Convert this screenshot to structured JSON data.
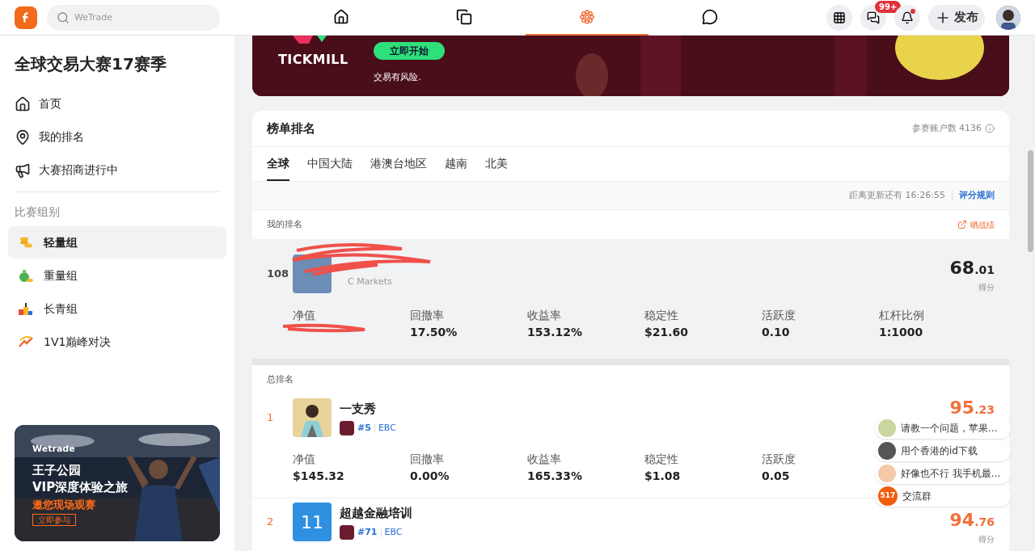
{
  "header": {
    "search": {
      "placeholder": "WeTrade"
    },
    "nav": [
      {
        "kind": "home",
        "selected": false
      },
      {
        "kind": "feed",
        "selected": false
      },
      {
        "kind": "contest",
        "selected": true
      },
      {
        "kind": "chat",
        "selected": false
      }
    ],
    "badge": "99+",
    "notification_dot": true,
    "publish": "发布"
  },
  "sidebar": {
    "title": "全球交易大赛17赛季",
    "links": [
      {
        "kind": "home",
        "label": "首页"
      },
      {
        "kind": "rank",
        "label": "我的排名"
      },
      {
        "kind": "megaphone",
        "label": "大赛招商进行中"
      }
    ],
    "section": "比赛组别",
    "groups": [
      {
        "kind": "coins",
        "label": "轻量组",
        "selected": true
      },
      {
        "kind": "moneybag",
        "label": "重量组",
        "selected": false
      },
      {
        "kind": "blocks",
        "label": "长青组",
        "selected": false
      },
      {
        "kind": "trend",
        "label": "1V1巅峰对决",
        "selected": false
      }
    ],
    "promo": {
      "brand": "Wetrade",
      "line1": "王子公园",
      "line2": "VIP深度体验之旅",
      "line3": "邀您现场观赛",
      "button": "立即参与"
    }
  },
  "banner": {
    "brand": "TICKMILL",
    "button": "立即开始",
    "note": "交易有风险."
  },
  "board": {
    "title": "榜单排名",
    "accounts": "参赛账户数 4136",
    "tabs": [
      {
        "label": "全球",
        "selected": true
      },
      {
        "label": "中国大陆",
        "selected": false
      },
      {
        "label": "港澳台地区",
        "selected": false
      },
      {
        "label": "越南",
        "selected": false
      },
      {
        "label": "北美",
        "selected": false
      }
    ],
    "countdown": "距离更新还有 16:26:55",
    "rules_link": "评分规则",
    "mine": {
      "heading": "我的排名",
      "share": "晒战绩",
      "rank": "108",
      "broker": "C Markets",
      "score_int": "68",
      "score_dec": ".01",
      "score_label": "得分",
      "metrics": [
        {
          "label": "净值"
        },
        {
          "label": "回撤率",
          "value": "17.50%"
        },
        {
          "label": "收益率",
          "value": "153.12%"
        },
        {
          "label": "稳定性",
          "value": "$21.60"
        },
        {
          "label": "活跃度",
          "value": "0.10"
        },
        {
          "label": "杠杆比例",
          "value": "1:1000"
        }
      ]
    },
    "overall_heading": "总排名",
    "rows": [
      {
        "rank": "1",
        "name": "一支秀",
        "avatar": {
          "kind": "picture"
        },
        "tag": "#5",
        "broker": "EBC",
        "score_int": "95",
        "score_dec": ".23",
        "metrics": [
          {
            "label": "净值",
            "value": "$145.32"
          },
          {
            "label": "回撤率",
            "value": "0.00%"
          },
          {
            "label": "收益率",
            "value": "165.33%"
          },
          {
            "label": "稳定性",
            "value": "$1.08"
          },
          {
            "label": "活跃度",
            "value": "0.05"
          }
        ]
      },
      {
        "rank": "2",
        "name": "超越金融培训",
        "avatar": {
          "kind": "text",
          "text": "11"
        },
        "tag": "#71",
        "broker": "EBC",
        "score_int": "94",
        "score_dec": ".76",
        "score_label": "得分",
        "metrics": []
      }
    ]
  },
  "chats": [
    {
      "kind": "avatar",
      "text": "请教一个问题，苹果..."
    },
    {
      "kind": "avatar",
      "text": "用个香港的id下载"
    },
    {
      "kind": "avatar",
      "text": "好像也不行 我手机最..."
    },
    {
      "kind": "count",
      "badge": "517",
      "text": "交流群"
    }
  ]
}
